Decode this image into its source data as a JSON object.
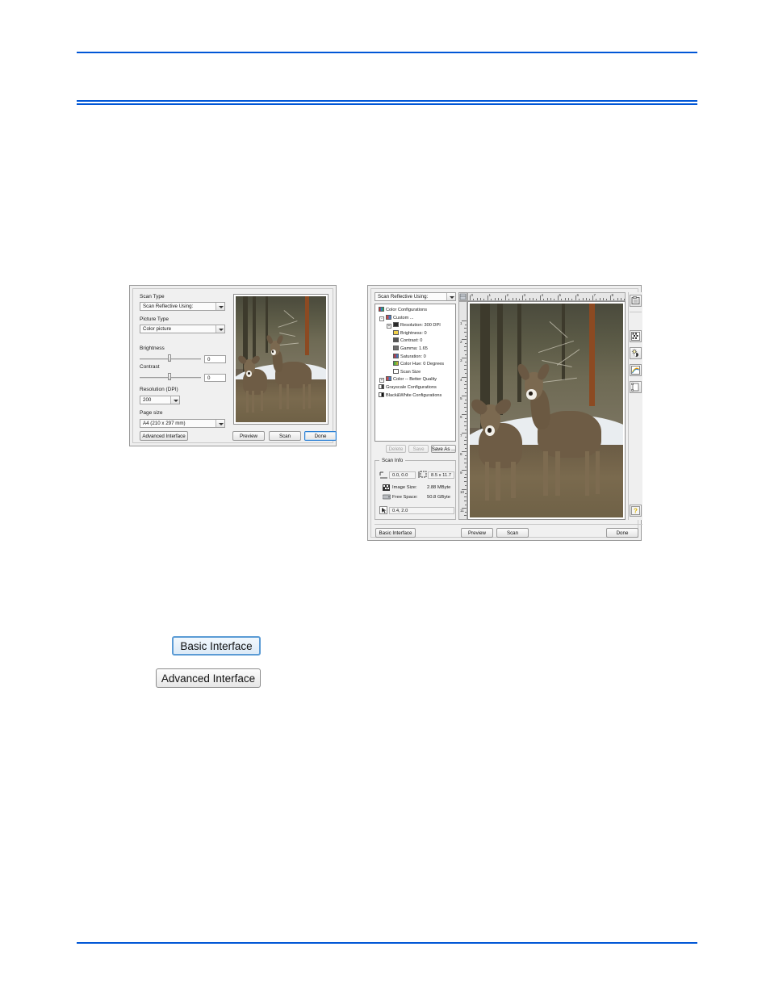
{
  "page": {
    "background": "#ffffff",
    "rule_color": "#0056d6"
  },
  "basic_dialog": {
    "name": "Basic Interface scanner dialog",
    "fields": {
      "scan_type_label": "Scan Type",
      "scan_type_value": "Scan Reflective Using:",
      "picture_type_label": "Picture Type",
      "picture_type_value": "Color picture",
      "brightness_label": "Brightness",
      "brightness_value": "0",
      "contrast_label": "Contrast",
      "contrast_value": "0",
      "resolution_label": "Resolution (DPI)",
      "resolution_value": "200",
      "page_size_label": "Page size",
      "page_size_value": "A4 (210 x 297 mm)"
    },
    "buttons": {
      "advanced_interface": "Advanced Interface",
      "preview": "Preview",
      "scan": "Scan",
      "done": "Done"
    }
  },
  "advanced_dialog": {
    "name": "Advanced Interface scanner dialog",
    "source_combo_value": "Scan Reflective Using:",
    "tree": [
      {
        "label": "Color Configurations",
        "depth": 0,
        "expander": "",
        "icon": "color-swatch-icon"
      },
      {
        "label": "Custom ...",
        "depth": 1,
        "expander": "-",
        "icon": "config-icon"
      },
      {
        "label": "Resolution: 300 DPI",
        "depth": 2,
        "expander": "+",
        "icon": "resolution-icon"
      },
      {
        "label": "Brightness: 0",
        "depth": 2,
        "expander": "",
        "icon": "brightness-icon"
      },
      {
        "label": "Contrast: 0",
        "depth": 2,
        "expander": "",
        "icon": "contrast-icon"
      },
      {
        "label": "Gamma: 1.65",
        "depth": 2,
        "expander": "",
        "icon": "gamma-icon"
      },
      {
        "label": "Saturation: 0",
        "depth": 2,
        "expander": "",
        "icon": "saturation-icon"
      },
      {
        "label": "Color Hue: 0 Degrees",
        "depth": 2,
        "expander": "",
        "icon": "color-hue-icon"
      },
      {
        "label": "Scan Size",
        "depth": 2,
        "expander": "",
        "icon": "scan-size-icon"
      },
      {
        "label": "Color -- Better Quality",
        "depth": 1,
        "expander": "+",
        "icon": "config-icon"
      },
      {
        "label": "Grayscale Configurations",
        "depth": 0,
        "expander": "",
        "icon": "grayscale-icon"
      },
      {
        "label": "Black&White Configurations",
        "depth": 0,
        "expander": "",
        "icon": "bw-icon"
      }
    ],
    "config_buttons": {
      "delete": "Delete",
      "save": "Save",
      "save_as": "Save As ..."
    },
    "scan_info": {
      "title": "Scan Info",
      "origin_value": "0.0, 0.0",
      "size_value": "8.5 x 11.7",
      "image_size_label": "Image Size:",
      "image_size_value": "2.88 MByte",
      "free_space_label": "Free Space:",
      "free_space_value": "50.8 GByte",
      "cursor_value": "0.4, 2.0"
    },
    "rulers": {
      "horizontal_ticks": [
        "0",
        "1",
        "2",
        "3",
        "4",
        "5",
        "6",
        "7",
        "8"
      ],
      "vertical_ticks": [
        "1",
        "2",
        "3",
        "4",
        "5",
        "6",
        "7",
        "8",
        "9",
        "10",
        "11"
      ]
    },
    "toolbar": [
      {
        "name": "preview-settings-icon"
      },
      {
        "name": "halftone-icon"
      },
      {
        "name": "brightness-contrast-icon"
      },
      {
        "name": "color-adjust-icon"
      },
      {
        "name": "scan-frame-icon"
      }
    ],
    "help_button": "help-icon",
    "buttons": {
      "basic_interface": "Basic Interface",
      "preview": "Preview",
      "scan": "Scan",
      "done": "Done"
    }
  },
  "standalone_buttons": {
    "basic_interface": "Basic Interface",
    "advanced_interface": "Advanced Interface"
  }
}
